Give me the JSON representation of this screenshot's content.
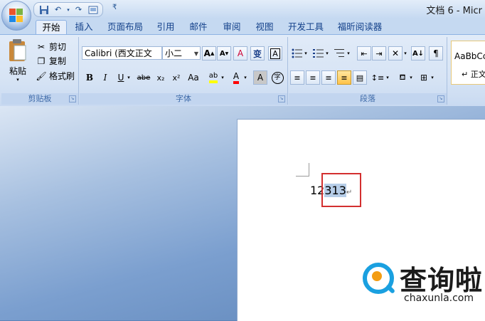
{
  "window": {
    "title": "文档 6 - Micr"
  },
  "quick_access": {
    "icons": [
      "save-icon",
      "undo-icon",
      "redo-icon",
      "print-preview-icon"
    ],
    "more": "₹"
  },
  "tabs": [
    "开始",
    "插入",
    "页面布局",
    "引用",
    "邮件",
    "审阅",
    "视图",
    "开发工具",
    "福昕阅读器"
  ],
  "active_tab": "开始",
  "clipboard": {
    "paste": "粘贴",
    "cut": "剪切",
    "copy": "复制",
    "format_painter": "格式刷",
    "group_label": "剪贴板"
  },
  "font": {
    "font_name": "Calibri (西文正文",
    "font_size": "小二",
    "group_label": "字体",
    "buttons": {
      "grow": "A",
      "shrink": "A",
      "clear": "A",
      "phonetic": "变",
      "border": "A",
      "bold": "B",
      "italic": "I",
      "underline": "U",
      "strike": "abe",
      "subscript": "x₂",
      "superscript": "x²",
      "case": "Aa",
      "highlight": "ab",
      "color": "A",
      "shading": "A",
      "enclose": "字"
    },
    "highlight_color": "#ffff00",
    "font_color": "#ff0000"
  },
  "paragraph": {
    "group_label": "段落"
  },
  "styles": {
    "preview": "AaBbCc",
    "normal": "↵ 正文"
  },
  "document": {
    "text_plain": "12",
    "text_selected": "313",
    "paragraph_mark": "↵"
  },
  "watermark": {
    "brand_cn": "查询啦",
    "brand_en": "chaxunla.com"
  },
  "colors": {
    "selection": "#b6cde8",
    "highlight_box": "#d32f2f",
    "accent": "#1aa0e0"
  }
}
